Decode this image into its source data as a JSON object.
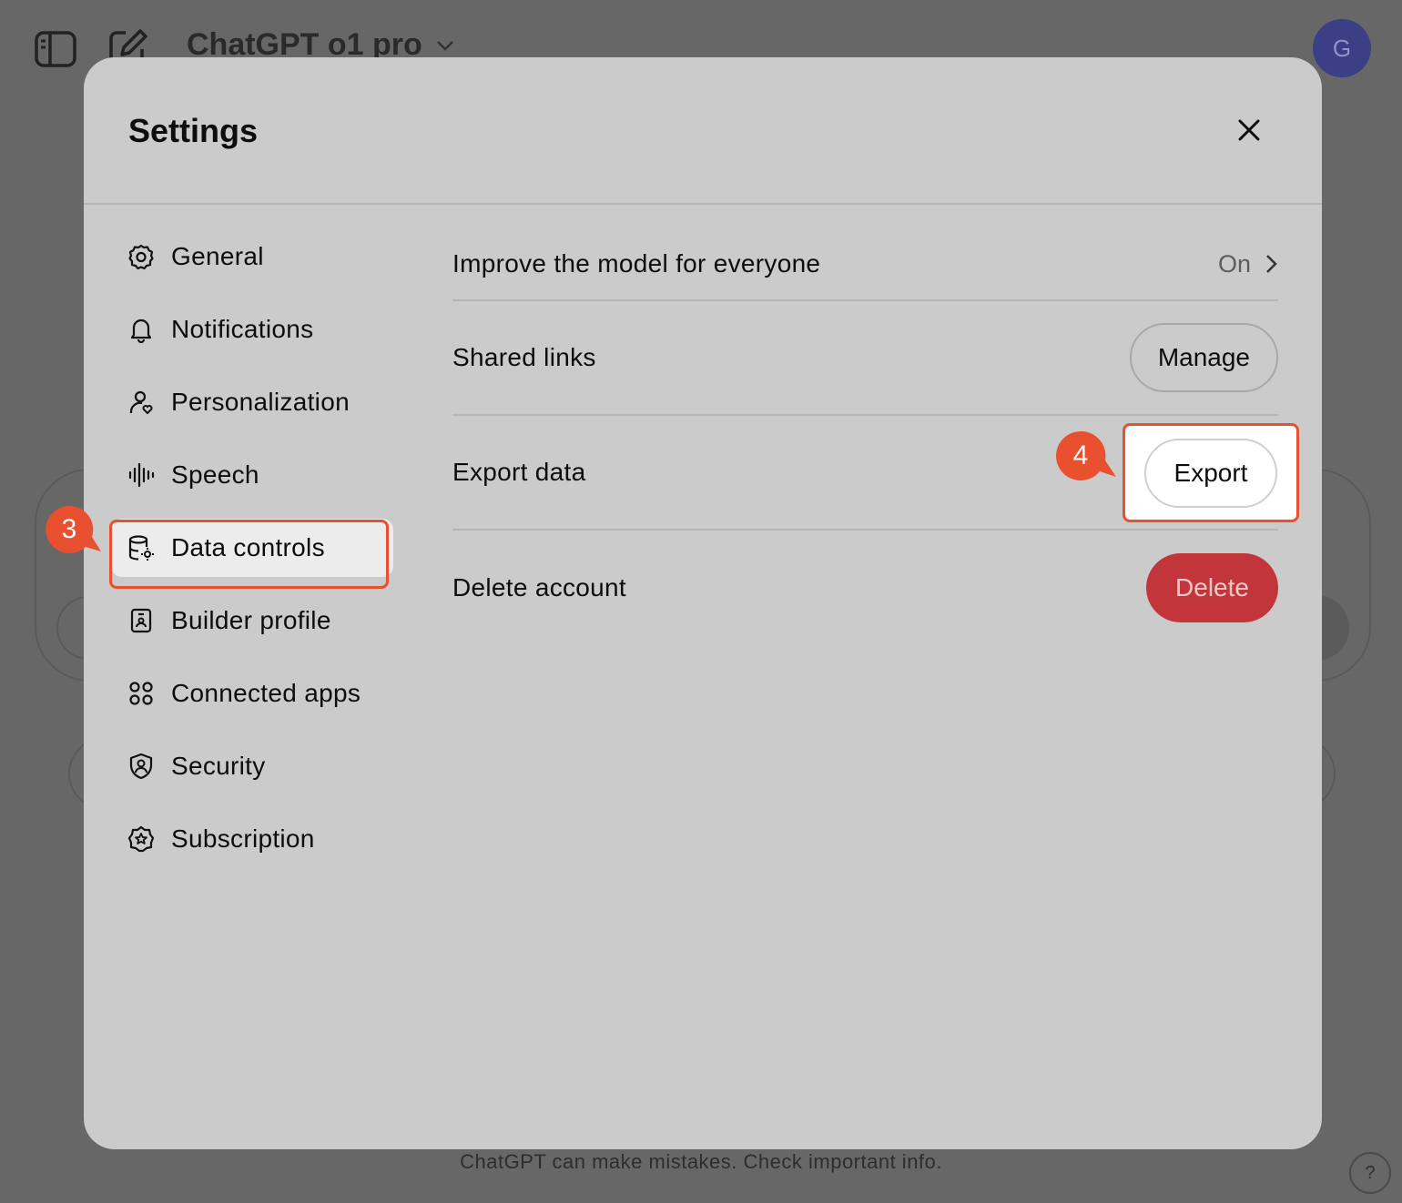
{
  "background": {
    "model_name": "ChatGPT o1 pro",
    "avatar_initial": "G",
    "footer_note": "ChatGPT can make mistakes. Check important info.",
    "help_label": "?"
  },
  "settings": {
    "title": "Settings",
    "nav": [
      {
        "label": "General",
        "icon": "gear-icon"
      },
      {
        "label": "Notifications",
        "icon": "bell-icon"
      },
      {
        "label": "Personalization",
        "icon": "person-icon"
      },
      {
        "label": "Speech",
        "icon": "waveform-icon"
      },
      {
        "label": "Data controls",
        "icon": "database-gear-icon",
        "active": true
      },
      {
        "label": "Builder profile",
        "icon": "id-badge-icon"
      },
      {
        "label": "Connected apps",
        "icon": "apps-grid-icon"
      },
      {
        "label": "Security",
        "icon": "shield-user-icon"
      },
      {
        "label": "Subscription",
        "icon": "star-badge-icon"
      }
    ],
    "rows": {
      "improve_model": {
        "label": "Improve the model for everyone",
        "value": "On"
      },
      "shared_links": {
        "label": "Shared links",
        "button": "Manage"
      },
      "export_data": {
        "label": "Export data",
        "button": "Export"
      },
      "delete_account": {
        "label": "Delete account",
        "button": "Delete"
      }
    }
  },
  "annotations": {
    "step_3": "3",
    "step_4": "4",
    "highlight_color": "#e8502f"
  },
  "colors": {
    "overlay_bg": "#676767",
    "modal_bg": "#cbcbcb",
    "danger": "#c2353a",
    "avatar_bg": "#3a3f86"
  }
}
